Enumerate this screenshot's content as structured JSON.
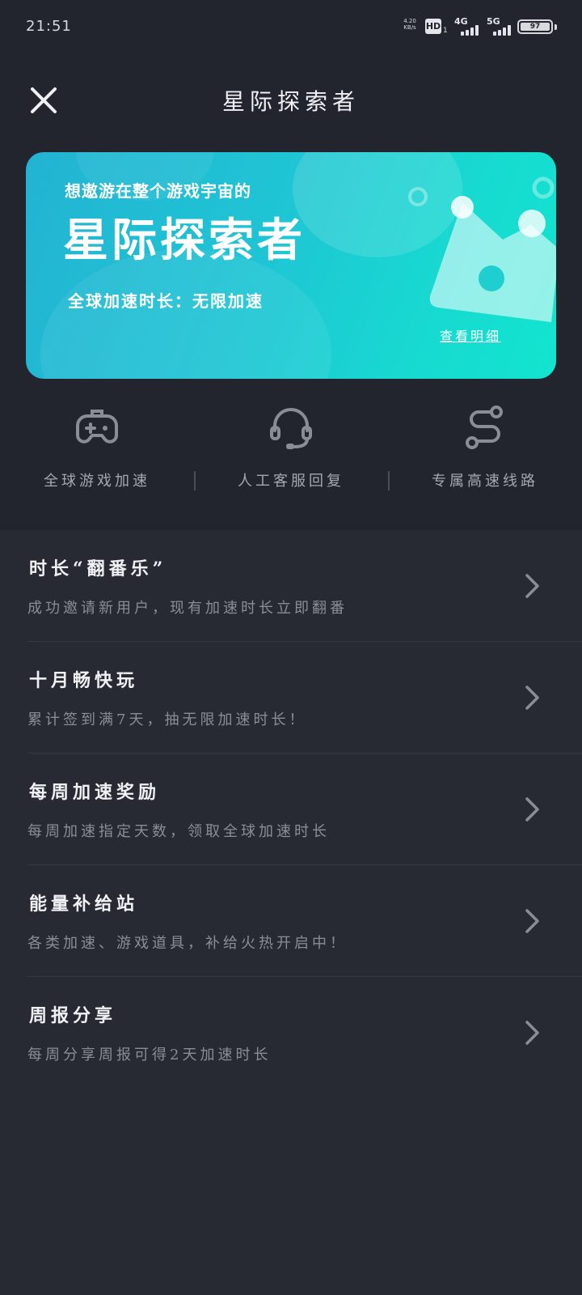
{
  "status_bar": {
    "time": "21:51",
    "net_speed_value": "4.20",
    "net_speed_unit": "KB/s",
    "hd_badge": "HD",
    "hd_sub": "1",
    "signal_4g": "4G",
    "signal_5g": "5G",
    "battery": "97"
  },
  "header": {
    "title": "星际探索者",
    "close_icon": "close-icon"
  },
  "banner": {
    "subtitle": "想遨游在整个游戏宇宙的",
    "title": "星际探索者",
    "duration": "全球加速时长：无限加速",
    "detail_link": "查看明细",
    "gradient_start": "#23b3d3",
    "gradient_end": "#12e4cf"
  },
  "features": [
    {
      "label": "全球游戏加速",
      "icon": "gamepad-icon"
    },
    {
      "label": "人工客服回复",
      "icon": "headset-icon"
    },
    {
      "label": "专属高速线路",
      "icon": "route-icon"
    }
  ],
  "list": [
    {
      "title": "时长“翻番乐”",
      "desc": "成功邀请新用户，现有加速时长立即翻番"
    },
    {
      "title": "十月畅快玩",
      "desc": "累计签到满7天，抽无限加速时长！"
    },
    {
      "title": "每周加速奖励",
      "desc": "每周加速指定天数，领取全球加速时长"
    },
    {
      "title": "能量补给站",
      "desc": "各类加速、游戏道具，补给火热开启中！"
    },
    {
      "title": "周报分享",
      "desc": "每周分享周报可得2天加速时长"
    }
  ],
  "colors": {
    "background": "#272a33",
    "top_background": "#22252e",
    "text_primary": "#f0f1f5",
    "text_secondary": "#8a8d97",
    "icon_gray": "#8a8d97"
  }
}
